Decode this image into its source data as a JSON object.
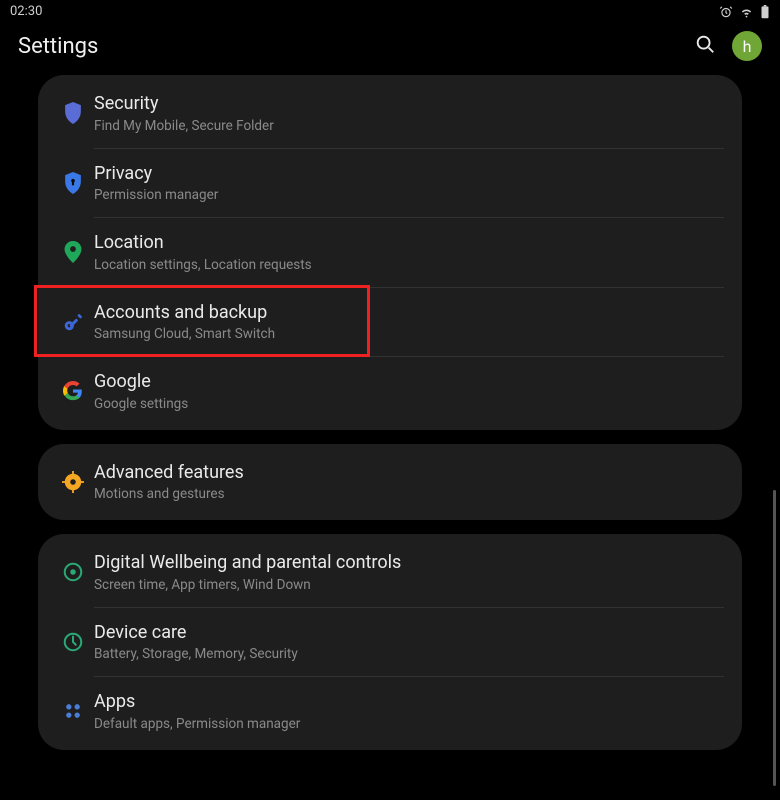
{
  "status": {
    "time": "02:30"
  },
  "header": {
    "title": "Settings"
  },
  "avatar": {
    "letter": "h"
  },
  "groups": [
    {
      "items": [
        {
          "icon": "shield-solid-icon",
          "color": "#5a6dd6",
          "title": "Security",
          "subtitle": "Find My Mobile, Secure Folder"
        },
        {
          "icon": "shield-lock-icon",
          "color": "#3b78e7",
          "title": "Privacy",
          "subtitle": "Permission manager"
        },
        {
          "icon": "location-pin-icon",
          "color": "#1fa85a",
          "title": "Location",
          "subtitle": "Location settings, Location requests"
        },
        {
          "icon": "key-icon",
          "color": "#3b67d8",
          "title": "Accounts and backup",
          "subtitle": "Samsung Cloud, Smart Switch",
          "highlighted": true
        },
        {
          "icon": "google-g-icon",
          "color": "#4285f4",
          "title": "Google",
          "subtitle": "Google settings"
        }
      ]
    },
    {
      "items": [
        {
          "icon": "gear-badge-icon",
          "color": "#f5a623",
          "title": "Advanced features",
          "subtitle": "Motions and gestures"
        }
      ]
    },
    {
      "items": [
        {
          "icon": "wellbeing-icon",
          "color": "#2aa876",
          "title": "Digital Wellbeing and parental controls",
          "subtitle": "Screen time, App timers, Wind Down"
        },
        {
          "icon": "device-care-icon",
          "color": "#2aa876",
          "title": "Device care",
          "subtitle": "Battery, Storage, Memory, Security"
        },
        {
          "icon": "apps-grid-icon",
          "color": "#4a7dd8",
          "title": "Apps",
          "subtitle": "Default apps, Permission manager"
        }
      ]
    }
  ]
}
